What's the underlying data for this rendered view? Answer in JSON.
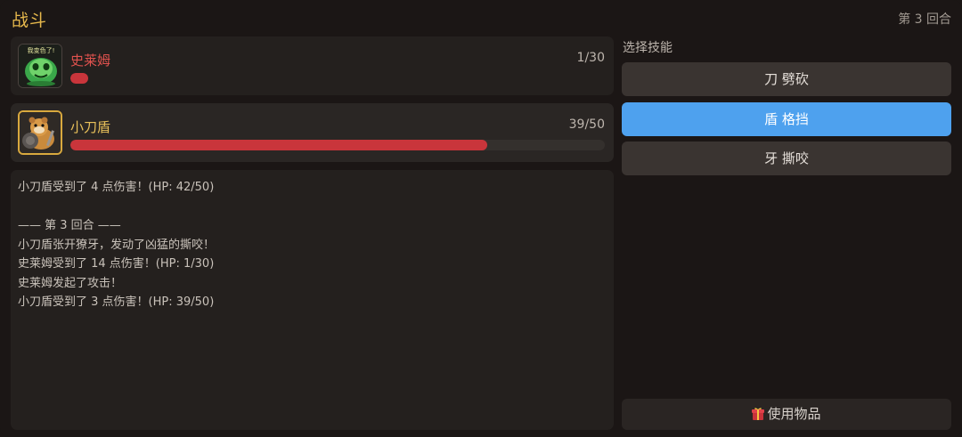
{
  "header": {
    "title": "战斗",
    "round": "第 3 回合"
  },
  "enemy": {
    "name": "史莱姆",
    "hp_text": "1/30",
    "hp_fraction": 0.0333,
    "avatar_caption": "我变色了!"
  },
  "player": {
    "name": "小刀盾",
    "hp_text": "39/50",
    "hp_fraction": 0.78
  },
  "log": [
    "小刀盾受到了 4 点伤害！(HP: 42/50)",
    "",
    "—— 第 3 回合 ——",
    "小刀盾张开獠牙，发动了凶猛的撕咬！",
    "史莱姆受到了 14 点伤害！(HP: 1/30)",
    "史莱姆发起了攻击！",
    "小刀盾受到了 3 点伤害！(HP: 39/50)"
  ],
  "skills": {
    "label": "选择技能",
    "buttons": [
      {
        "label": "刀 劈砍",
        "selected": false
      },
      {
        "label": "盾 格挡",
        "selected": true
      },
      {
        "label": "牙 撕咬",
        "selected": false
      }
    ]
  },
  "items": {
    "label": "使用物品",
    "icon": "gift-box-icon"
  },
  "colors": {
    "accent": "#e6b84c",
    "hp_bar": "#c9353b",
    "selected": "#4ea1ee",
    "enemy_name": "#e0524e"
  }
}
